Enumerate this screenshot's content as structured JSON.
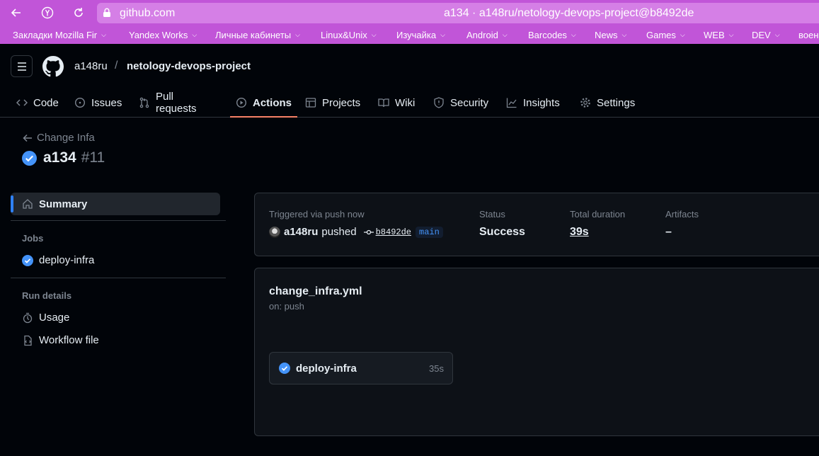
{
  "browser": {
    "host": "github.com",
    "title": "a134 · a148ru/netology-devops-project@b8492de"
  },
  "bookmarks": [
    "Закладки Mozilla Fir",
    "Yandex Works",
    "Личные кабинеты",
    "Linux&Unix",
    "Изучайка",
    "Android",
    "Barcodes",
    "News",
    "Games",
    "WEB",
    "DEV",
    "воен"
  ],
  "repo": {
    "owner": "a148ru",
    "slash": "/",
    "name": "netology-devops-project"
  },
  "tabs": [
    {
      "label": "Code",
      "icon": "code-icon"
    },
    {
      "label": "Issues",
      "icon": "issue-icon"
    },
    {
      "label": "Pull requests",
      "icon": "pull-request-icon"
    },
    {
      "label": "Actions",
      "icon": "play-icon",
      "active": true
    },
    {
      "label": "Projects",
      "icon": "table-icon"
    },
    {
      "label": "Wiki",
      "icon": "book-icon"
    },
    {
      "label": "Security",
      "icon": "shield-icon"
    },
    {
      "label": "Insights",
      "icon": "graph-icon"
    },
    {
      "label": "Settings",
      "icon": "gear-icon"
    }
  ],
  "run": {
    "back_label": "Change Infa",
    "name": "a134",
    "number": "#11"
  },
  "sidebar": {
    "summary": "Summary",
    "jobs_heading": "Jobs",
    "job": "deploy-infra",
    "run_details_heading": "Run details",
    "usage": "Usage",
    "workflow_file": "Workflow file"
  },
  "summary": {
    "trigger_label": "Triggered via push now",
    "actor": "a148ru",
    "action": "pushed",
    "commit": "b8492de",
    "branch": "main",
    "status_label": "Status",
    "status_value": "Success",
    "duration_label": "Total duration",
    "duration_value": "39s",
    "artifacts_label": "Artifacts",
    "artifacts_value": "–"
  },
  "workflow": {
    "file": "change_infra.yml",
    "trigger": "on: push",
    "job_name": "deploy-infra",
    "job_duration": "35s"
  },
  "colors": {
    "accent": "#2f81f7",
    "success_check": "#4493f8",
    "tab_underline": "#f78166",
    "browser_bar": "#c155d8"
  }
}
